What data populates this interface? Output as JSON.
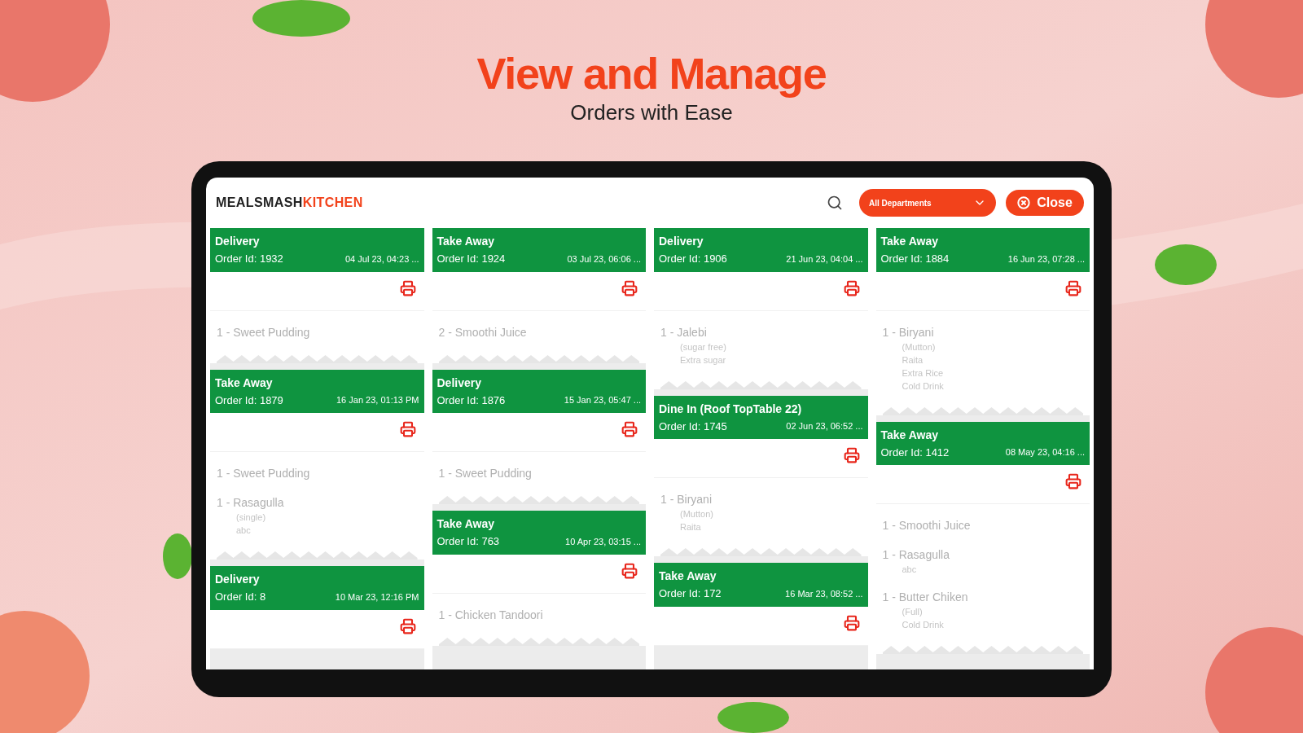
{
  "heading": {
    "title": "View and Manage",
    "subtitle": "Orders with Ease"
  },
  "app": {
    "logo": {
      "dark_part": "MEALSMASH",
      "accent_part": "KITCHEN"
    },
    "department_select": {
      "value": "All Departments"
    },
    "close_button": {
      "label": "Close"
    },
    "columns": [
      {
        "orders": [
          {
            "type": "Delivery",
            "order_id": "Order Id: 1932",
            "date": "04 Jul 23, 04:23 ...",
            "items": [
              {
                "name": "1 - Sweet Pudding"
              }
            ]
          },
          {
            "type": "Take Away",
            "order_id": "Order Id: 1879",
            "date": "16 Jan 23, 01:13 PM",
            "items": [
              {
                "name": "1 - Sweet Pudding"
              },
              {
                "name": "1 - Rasagulla",
                "notes": [
                  "(single)",
                  "abc"
                ]
              }
            ]
          },
          {
            "type": "Delivery",
            "order_id": "Order Id: 8",
            "date": "10 Mar 23, 12:16 PM"
          }
        ]
      },
      {
        "orders": [
          {
            "type": "Take Away",
            "order_id": "Order Id: 1924",
            "date": "03 Jul 23, 06:06 ...",
            "items": [
              {
                "name": "2 - Smoothi Juice"
              }
            ]
          },
          {
            "type": "Delivery",
            "order_id": "Order Id: 1876",
            "date": "15 Jan 23, 05:47 ...",
            "items": [
              {
                "name": "1 - Sweet Pudding"
              }
            ]
          },
          {
            "type": "Take Away",
            "order_id": "Order Id: 763",
            "date": "10 Apr 23, 03:15 ...",
            "items": [
              {
                "name": "1 - Chicken Tandoori"
              }
            ]
          }
        ]
      },
      {
        "orders": [
          {
            "type": "Delivery",
            "order_id": "Order Id: 1906",
            "date": "21 Jun 23, 04:04 ...",
            "items": [
              {
                "name": "1 - Jalebi",
                "notes": [
                  "(sugar free)",
                  "Extra sugar"
                ]
              }
            ]
          },
          {
            "type": "Dine In (Roof TopTable 22)",
            "order_id": "Order Id: 1745",
            "date": "02 Jun 23, 06:52 ...",
            "items": [
              {
                "name": "1 - Biryani",
                "notes": [
                  "(Mutton)",
                  "Raita"
                ]
              }
            ]
          },
          {
            "type": "Take Away",
            "order_id": "Order Id: 172",
            "date": "16 Mar 23, 08:52 ..."
          }
        ]
      },
      {
        "orders": [
          {
            "type": "Take Away",
            "order_id": "Order Id: 1884",
            "date": "16 Jun 23, 07:28 ...",
            "items": [
              {
                "name": "1 - Biryani",
                "notes": [
                  "(Mutton)",
                  "Raita",
                  "Extra Rice",
                  "Cold Drink"
                ]
              }
            ]
          },
          {
            "type": "Take Away",
            "order_id": "Order Id: 1412",
            "date": "08 May 23, 04:16 ...",
            "items": [
              {
                "name": "1 - Smoothi Juice"
              },
              {
                "name": "1 - Rasagulla",
                "notes": [
                  "abc"
                ]
              },
              {
                "name": "1 - Butter Chiken",
                "notes": [
                  "(Full)",
                  "Cold Drink"
                ]
              }
            ]
          }
        ]
      }
    ]
  }
}
